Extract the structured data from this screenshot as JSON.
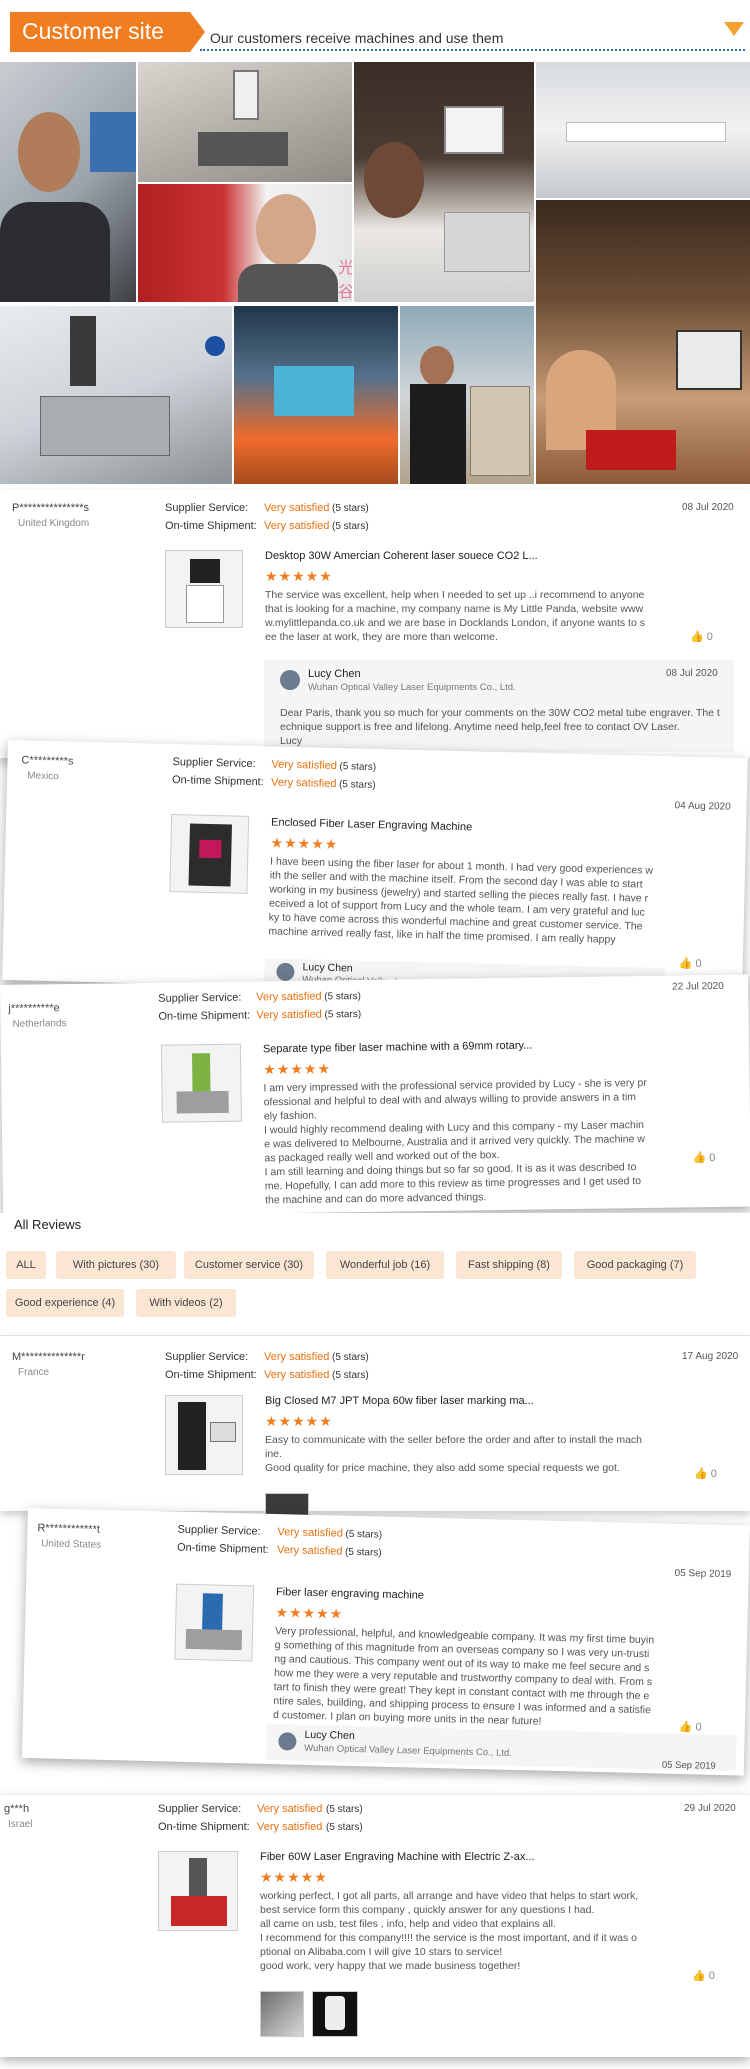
{
  "banner": {
    "title": "Customer site",
    "subtitle": "Our customers receive machines and use them",
    "colors": {
      "tab": "#f07d20",
      "dotted_line": "#2b6cb0",
      "arrow": "#f3a132"
    }
  },
  "watermark": "光谷激光",
  "reviews_top": [
    {
      "name": "P***************s",
      "country": "United Kingdom",
      "supplier_service_label": "Supplier Service:",
      "supplier_service_value": "Very satisfied",
      "supplier_service_stars": "(5 stars)",
      "shipment_label": "On-time Shipment:",
      "shipment_value": "Very satisfied",
      "shipment_stars": "(5 stars)",
      "date": "08 Jul 2020",
      "product": "Desktop 30W Amercian Coherent laser souece CO2 L...",
      "rating": "★★★★★",
      "text": "The service was excellent, help when I needed to set up ..i recommend to anyone\nthat is looking for a machine, my company name is My Little Panda, website www\nw.mylittlepanda.co.uk and we are base in Docklands London, if anyone wants to s\nee the laser at work, they are more than welcome.",
      "likes": "0",
      "reply": {
        "name": "Lucy Chen",
        "company": "Wuhan Optical Valley Laser Equipments Co., Ltd.",
        "date": "08 Jul 2020",
        "text": "Dear Paris, thank you so much for your comments on the 30W CO2 metal tube engraver. The t\nechnique support is free and lifelong. Anytime need help,feel free to contact OV Laser.\nLucy"
      }
    },
    {
      "name": "C*********s",
      "country": "Mexico",
      "supplier_service_label": "Supplier Service:",
      "supplier_service_value": "Very satisfied",
      "supplier_service_stars": "(5 stars)",
      "shipment_label": "On-time Shipment:",
      "shipment_value": "Very satisfied",
      "shipment_stars": "(5 stars)",
      "date": "04 Aug 2020",
      "product": "Enclosed Fiber Laser Engraving Machine",
      "rating": "★★★★★",
      "text": "I have been using the fiber laser for about 1 month. I had very good experiences w\nith the seller and with the machine itself. From the second day I was able to start\nworking in my business (jewelry) and started selling the pieces really fast. I have r\neceived a lot of support from Lucy and the whole team. I am very grateful and luc\nky to have come across this wonderful machine and great customer service. The\nmachine arrived really fast, like in half the time promised. I am really happy",
      "likes": "0",
      "reply": {
        "name": "Lucy Chen",
        "company": "Wuhan Optical Valley L..."
      }
    },
    {
      "name": "j**********e",
      "country": "Netherlands",
      "supplier_service_label": "Supplier Service:",
      "supplier_service_value": "Very satisfied",
      "supplier_service_stars": "(5 stars)",
      "shipment_label": "On-time Shipment:",
      "shipment_value": "Very satisfied",
      "shipment_stars": "(5 stars)",
      "date": "22 Jul 2020",
      "product": "Separate type fiber laser machine with a 69mm rotary...",
      "rating": "★★★★★",
      "text": "I am very impressed with the professional service provided by Lucy - she is very pr\nofessional and helpful to deal with and always willing to provide answers in a tim\nely fashion.\nI would highly recommend dealing with Lucy and this company - my Laser machin\ne was delivered to Melbourne, Australia and it arrived very quickly. The machine w\nas packaged really well and worked out of the box.\nI am still learning and doing things but so far so good. It is as it was described to\nme. Hopefully, I can add more to this review as time progresses and I get used to\nthe machine and can do more advanced things.",
      "likes": "0"
    }
  ],
  "all_reviews": {
    "title": "All Reviews",
    "chips": [
      "ALL",
      "With pictures (30)",
      "Customer service (30)",
      "Wonderful job (16)",
      "Fast shipping (8)",
      "Good packaging (7)",
      "Good experience (4)",
      "With videos (2)"
    ]
  },
  "reviews_bottom": [
    {
      "name": "M**************r",
      "country": "France",
      "supplier_service_label": "Supplier Service:",
      "supplier_service_value": "Very satisfied",
      "supplier_service_stars": "(5 stars)",
      "shipment_label": "On-time Shipment:",
      "shipment_value": "Very satisfied",
      "shipment_stars": "(5 stars)",
      "date": "17 Aug 2020",
      "product": "Big Closed M7 JPT Mopa 60w fiber laser marking ma...",
      "rating": "★★★★★",
      "text": "Easy to communicate with the seller before the order and after to install the mach\nine.\nGood quality for price machine, they also add some special requests we got.",
      "likes": "0"
    },
    {
      "name": "R************t",
      "country": "United States",
      "supplier_service_label": "Supplier Service:",
      "supplier_service_value": "Very satisfied",
      "supplier_service_stars": "(5 stars)",
      "shipment_label": "On-time Shipment:",
      "shipment_value": "Very satisfied",
      "shipment_stars": "(5 stars)",
      "date": "05 Sep 2019",
      "product": "Fiber laser engraving machine",
      "rating": "★★★★★",
      "text": "Very professional, helpful, and knowledgeable company. It was my first time buyin\ng something of this magnitude from an overseas company so I was very un-trusti\nng and cautious. This company went out of its way to make me feel secure and s\nhow me they were a very reputable and trustworthy company to deal with. From s\ntart to finish they were great! They kept in constant contact with me through the e\nntire sales, building, and shipping process to ensure I was informed and a satisfie\nd customer. I plan on buying more units in the near future!",
      "likes": "0",
      "reply": {
        "name": "Lucy Chen",
        "company": "Wuhan Optical Valley Laser Equipments Co., Ltd.",
        "date": "05 Sep 2019"
      }
    },
    {
      "name": "g***h",
      "country": "Israel",
      "supplier_service_label": "Supplier Service:",
      "supplier_service_value": "Very satisfied",
      "supplier_service_stars": "(5 stars)",
      "shipment_label": "On-time Shipment:",
      "shipment_value": "Very satisfied",
      "shipment_stars": "(5 stars)",
      "date": "29 Jul 2020",
      "product": "Fiber 60W Laser Engraving Machine with Electric Z-ax...",
      "rating": "★★★★★",
      "text": "working perfect, I got all parts, all arrange  and have video that helps to start work,\nbest service form this company , quickly answer for any questions I had.\nall came on usb, test files , info, help and video that explains all.\nI recommend for this company!!!! the service is the most important, and if it was o\nptional on Alibaba.com I will give 10 stars to service!\ngood work, very happy that we made business together!",
      "likes": "0"
    }
  ]
}
